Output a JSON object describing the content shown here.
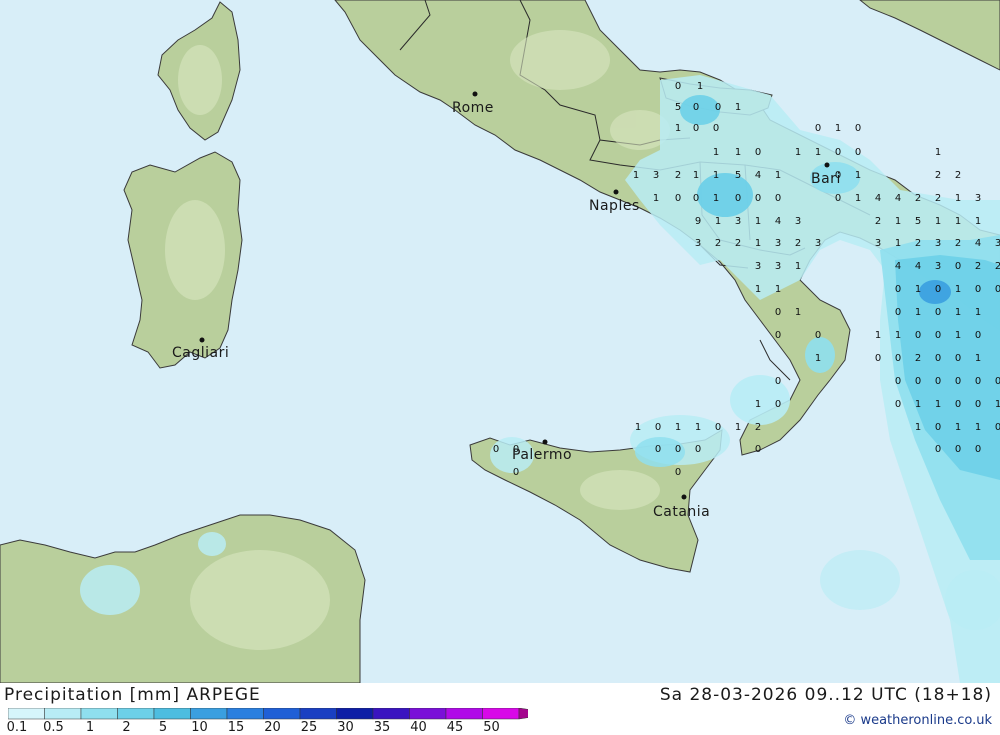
{
  "map": {
    "cities": [
      {
        "name": "Rome"
      },
      {
        "name": "Naples"
      },
      {
        "name": "Bari"
      },
      {
        "name": "Cagliari"
      },
      {
        "name": "Palermo"
      },
      {
        "name": "Catania"
      }
    ],
    "precip_values": [
      "0",
      "1",
      "5",
      "0",
      "0",
      "1",
      "1",
      "0",
      "0",
      "0",
      "1",
      "0",
      "1",
      "1",
      "0",
      "1",
      "1",
      "0",
      "0",
      "1",
      "1",
      "3",
      "2",
      "1",
      "1",
      "5",
      "4",
      "1",
      "0",
      "1",
      "2",
      "2",
      "1",
      "0",
      "0",
      "1",
      "0",
      "0",
      "0",
      "0",
      "1",
      "4",
      "4",
      "2",
      "2",
      "1",
      "3",
      "9",
      "1",
      "3",
      "1",
      "4",
      "3",
      "2",
      "1",
      "5",
      "1",
      "1",
      "1",
      "3",
      "2",
      "2",
      "1",
      "3",
      "2",
      "3",
      "3",
      "1",
      "2",
      "3",
      "2",
      "4",
      "3",
      "3",
      "3",
      "1",
      "4",
      "4",
      "3",
      "0",
      "2",
      "2",
      "1",
      "1",
      "0",
      "1",
      "0",
      "1",
      "0",
      "0",
      "0",
      "1",
      "0",
      "1",
      "0",
      "1",
      "1",
      "0",
      "0",
      "1",
      "1",
      "0",
      "0",
      "1",
      "0",
      "1",
      "0",
      "0",
      "2",
      "0",
      "0",
      "1",
      "0",
      "0",
      "0",
      "0",
      "0",
      "0",
      "0",
      "1",
      "0",
      "0",
      "1",
      "1",
      "0",
      "0",
      "1",
      "1",
      "0",
      "1",
      "1",
      "0",
      "1",
      "2",
      "1",
      "0",
      "1",
      "1",
      "0",
      "0",
      "0",
      "0",
      "0",
      "0",
      "0",
      "0",
      "0",
      "0",
      "0",
      "0"
    ]
  },
  "footer": {
    "title": "Precipitation [mm] ARPEGE",
    "date": "Sa 28-03-2026 09..12 UTC (18+18)",
    "credit": "© weatheronline.co.uk"
  },
  "legend": {
    "ticks": [
      "0.1",
      "0.5",
      "1",
      "2",
      "5",
      "10",
      "15",
      "20",
      "25",
      "30",
      "35",
      "40",
      "45",
      "50"
    ],
    "colors": [
      "#d6f5fb",
      "#b8ecf5",
      "#8fdfee",
      "#6dd0e8",
      "#4dbde0",
      "#3a9fe0",
      "#2a7fdf",
      "#1f5fd6",
      "#1a3fc2",
      "#0e1ea6",
      "#3a14c0",
      "#7a10d8",
      "#b00ae8",
      "#d808e8",
      "#a4068e"
    ]
  }
}
